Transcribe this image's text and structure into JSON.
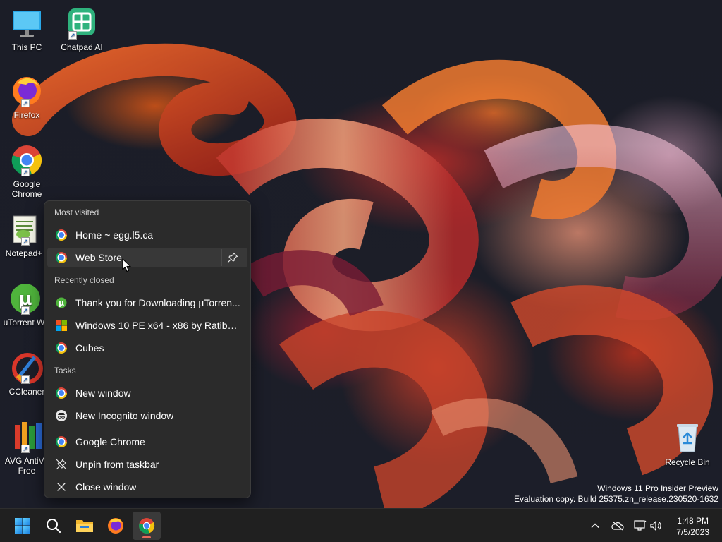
{
  "desktop": {
    "icons": [
      {
        "label": "This PC",
        "icon": "monitor-icon"
      },
      {
        "label": "Chatpad AI",
        "icon": "chatpad-icon"
      },
      {
        "label": "Firefox",
        "icon": "firefox-icon"
      },
      {
        "label": "Google Chrome",
        "icon": "chrome-icon"
      },
      {
        "label": "Notepad+",
        "icon": "notepad-plus-icon"
      },
      {
        "label": "uTorrent W",
        "icon": "utorrent-icon"
      },
      {
        "label": "CCleaner",
        "icon": "ccleaner-icon"
      },
      {
        "label": "AVG AntiVir Free",
        "icon": "avg-icon"
      },
      {
        "label": "Recycle Bin",
        "icon": "recycle-bin-icon"
      }
    ]
  },
  "jumplist": {
    "most_visited_header": "Most visited",
    "most_visited": [
      {
        "label": "Home ~ egg.l5.ca",
        "icon": "chrome-icon"
      },
      {
        "label": "Web Store",
        "icon": "chrome-icon",
        "hovered": true
      }
    ],
    "recently_closed_header": "Recently closed",
    "recently_closed": [
      {
        "label": "Thank you for Downloading µTorren...",
        "icon": "utorrent-icon"
      },
      {
        "label": "Windows 10 PE x64 - x86 by Ratibor...",
        "icon": "windows-pe-icon"
      },
      {
        "label": "Cubes",
        "icon": "chrome-icon"
      }
    ],
    "tasks_header": "Tasks",
    "tasks": [
      {
        "label": "New window",
        "icon": "chrome-icon"
      },
      {
        "label": "New Incognito window",
        "icon": "incognito-icon"
      }
    ],
    "actions": [
      {
        "label": "Google Chrome",
        "icon": "chrome-icon"
      },
      {
        "label": "Unpin from taskbar",
        "icon": "unpin-icon"
      },
      {
        "label": "Close window",
        "icon": "close-icon"
      }
    ]
  },
  "watermark": {
    "line1": "Windows 11 Pro Insider Preview",
    "line2": "Evaluation copy. Build 25375.zn_release.230520-1632"
  },
  "taskbar": {
    "apps": [
      "start-icon",
      "search-icon",
      "file-explorer-icon",
      "firefox-icon",
      "chrome-icon"
    ],
    "active_app": "chrome-icon",
    "tray": [
      "chevron-up-icon",
      "cloud-off-icon",
      "network-icon",
      "volume-icon"
    ],
    "time": "1:48 PM",
    "date": "7/5/2023"
  }
}
